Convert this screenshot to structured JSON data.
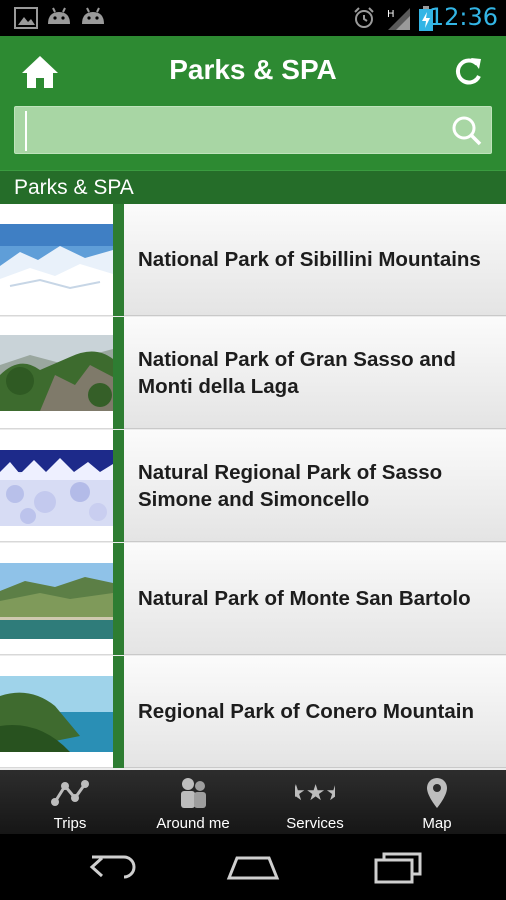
{
  "status_bar": {
    "time": "12:36",
    "icons": [
      "gallery-icon",
      "android-icon",
      "android-icon",
      "alarm-icon",
      "signal-icon",
      "battery-charging-icon"
    ]
  },
  "header": {
    "title": "Parks & SPA",
    "home_icon": "home-icon",
    "refresh_icon": "refresh-icon",
    "search": {
      "value": "",
      "placeholder": "",
      "icon": "search-icon"
    }
  },
  "section": {
    "title": "Parks & SPA"
  },
  "list": {
    "items": [
      {
        "label": "National Park of Sibillini Mountains",
        "thumb": "snowy-mountains"
      },
      {
        "label": "National Park of Gran Sasso and Monti della Laga",
        "thumb": "forest-cliffs"
      },
      {
        "label": "Natural Regional Park of Sasso Simone and Simoncello",
        "thumb": "frosted-trees"
      },
      {
        "label": "Natural Park of Monte San Bartolo",
        "thumb": "coastal-hills"
      },
      {
        "label": "Regional Park of Conero Mountain",
        "thumb": "sea-cliff"
      }
    ]
  },
  "tabs": [
    {
      "label": "Trips",
      "icon": "trips-route-icon"
    },
    {
      "label": "Around me",
      "icon": "people-icon"
    },
    {
      "label": "Services",
      "icon": "stars-icon"
    },
    {
      "label": "Map",
      "icon": "map-pin-icon"
    }
  ],
  "nav": [
    "back-icon",
    "home-icon",
    "recents-icon"
  ],
  "colors": {
    "header_green": "#2d8a32",
    "section_green": "#256d29",
    "search_field": "#a8d6a4",
    "time_blue": "#33b5e5"
  }
}
